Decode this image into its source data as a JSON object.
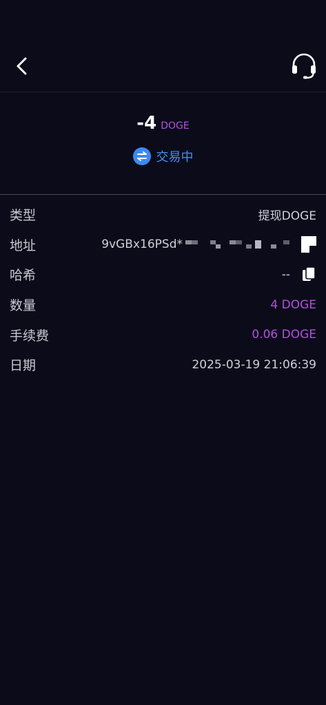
{
  "header": {
    "back_icon": "chevron-left-icon",
    "support_icon": "headset-icon"
  },
  "summary": {
    "amount": "-4",
    "unit": "DOGE",
    "status": "交易中",
    "status_icon": "swap-icon",
    "status_color": "#3f8ff2",
    "accent_color": "#b44fe0"
  },
  "details": {
    "type": {
      "label": "类型",
      "value": "提现DOGE"
    },
    "address": {
      "label": "地址",
      "value": "9vGBx16PSd*"
    },
    "hash": {
      "label": "哈希",
      "value": "--"
    },
    "quantity": {
      "label": "数量",
      "value": "4 DOGE"
    },
    "fee": {
      "label": "手续费",
      "value": "0.06 DOGE"
    },
    "date": {
      "label": "日期",
      "value": "2025-03-19 21:06:39"
    }
  }
}
